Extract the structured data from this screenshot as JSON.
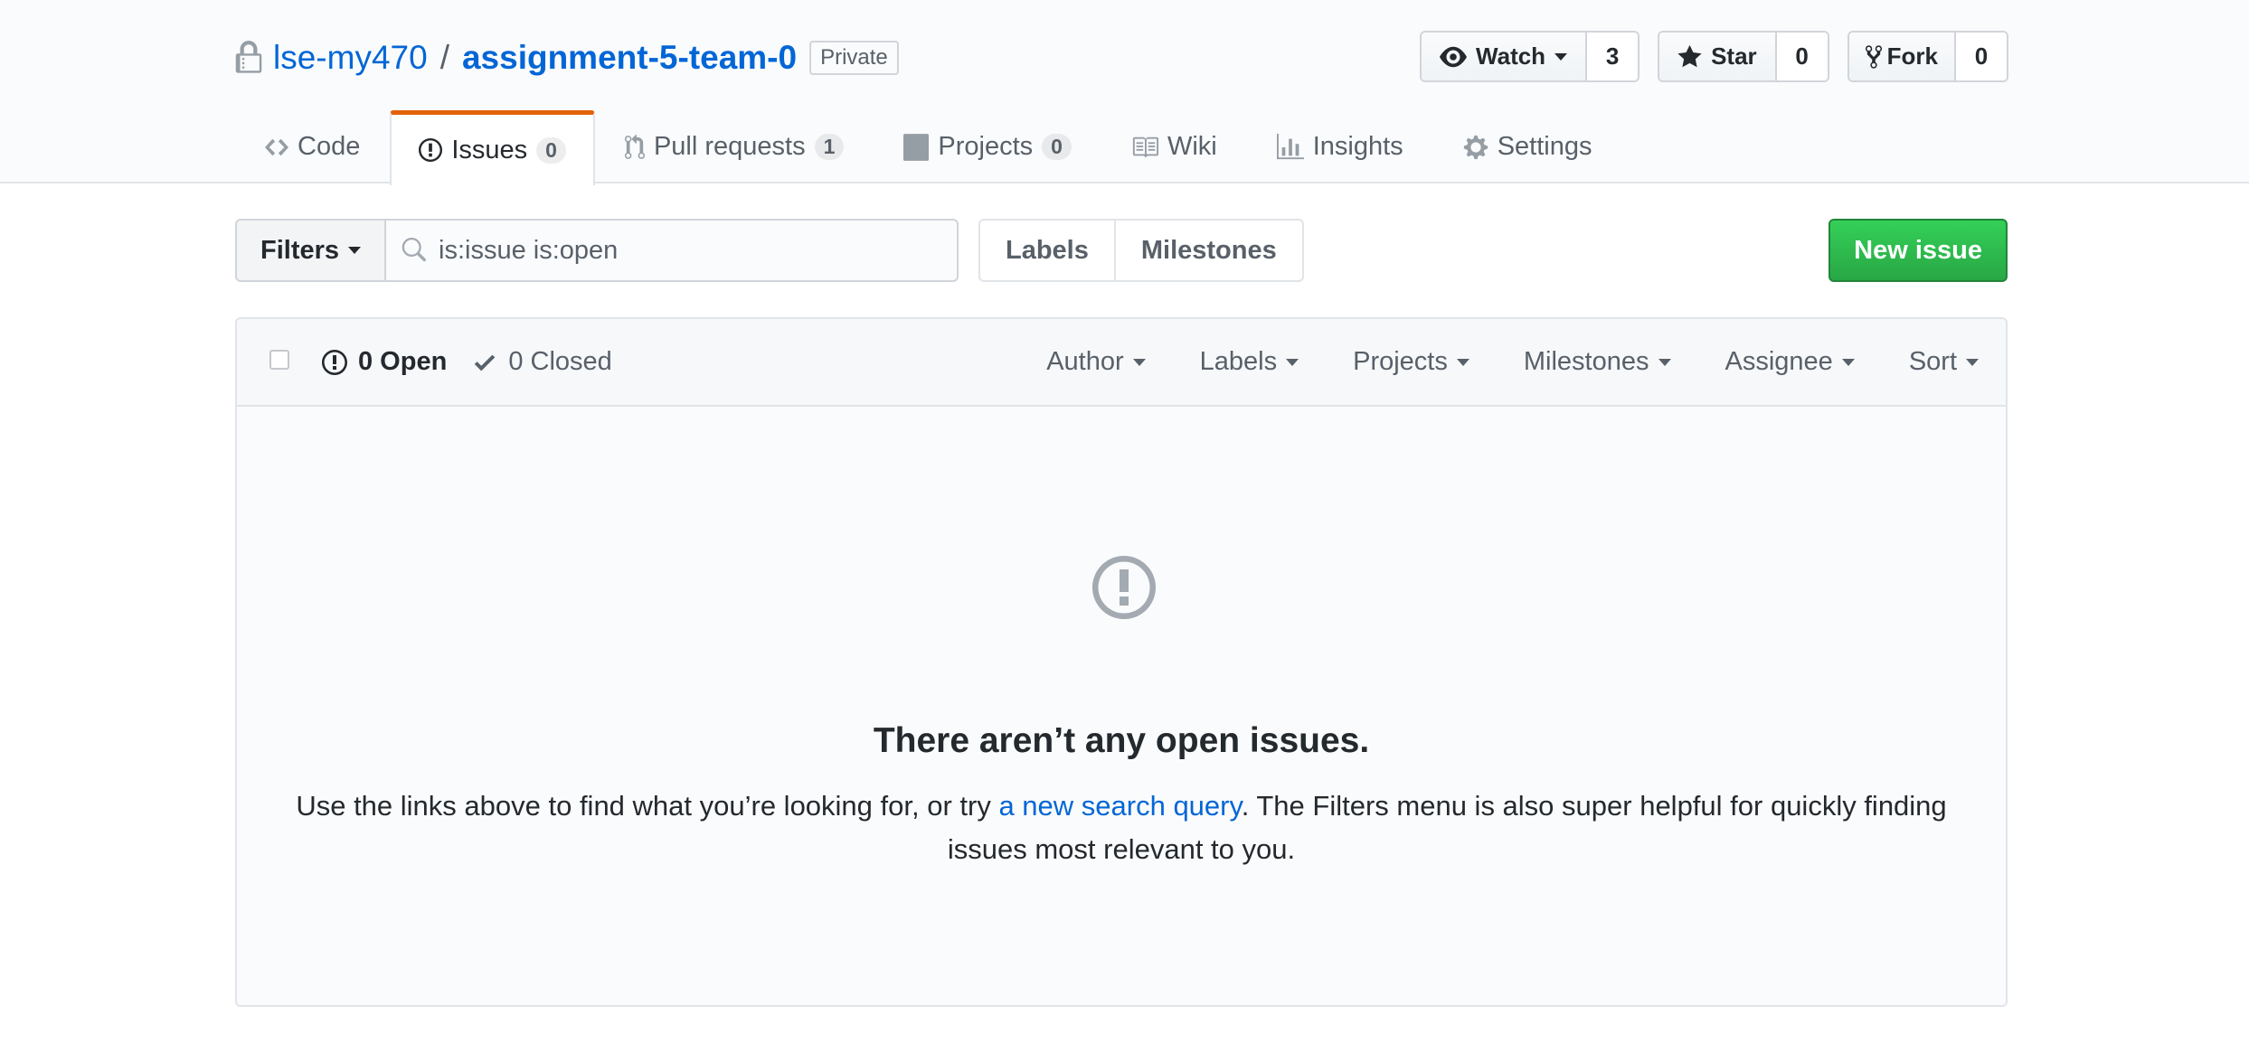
{
  "repo": {
    "owner": "lse-my470",
    "separator": "/",
    "name": "assignment-5-team-0",
    "visibility": "Private"
  },
  "actions": {
    "watch": {
      "label": "Watch",
      "count": "3",
      "icon": "eye-icon"
    },
    "star": {
      "label": "Star",
      "count": "0",
      "icon": "star-icon"
    },
    "fork": {
      "label": "Fork",
      "count": "0",
      "icon": "fork-icon"
    }
  },
  "nav": {
    "code": {
      "label": "Code",
      "icon": "code-icon"
    },
    "issues": {
      "label": "Issues",
      "count": "0",
      "icon": "issue-opened-icon"
    },
    "pulls": {
      "label": "Pull requests",
      "count": "1",
      "icon": "git-pull-request-icon"
    },
    "projects": {
      "label": "Projects",
      "count": "0",
      "icon": "project-icon"
    },
    "wiki": {
      "label": "Wiki",
      "icon": "book-icon"
    },
    "insights": {
      "label": "Insights",
      "icon": "graph-icon"
    },
    "settings": {
      "label": "Settings",
      "icon": "gear-icon"
    }
  },
  "subnav": {
    "filters_label": "Filters",
    "search_value": "is:issue is:open",
    "labels_link": "Labels",
    "milestones_link": "Milestones",
    "new_issue_label": "New issue"
  },
  "issues_header": {
    "open_label": "0 Open",
    "closed_label": "0 Closed",
    "filters": {
      "author": "Author",
      "labels": "Labels",
      "projects": "Projects",
      "milestones": "Milestones",
      "assignee": "Assignee",
      "sort": "Sort"
    }
  },
  "blankslate": {
    "title": "There aren’t any open issues.",
    "text_before": "Use the links above to find what you’re looking for, or try ",
    "link_text": "a new search query",
    "text_after": ". The Filters menu is also super helpful for quickly finding issues most relevant to you."
  },
  "colors": {
    "link": "#0366d6",
    "selected_tab_accent": "#e36209",
    "new_issue_green": "#28a745",
    "text": "#24292e",
    "muted": "#586069"
  }
}
